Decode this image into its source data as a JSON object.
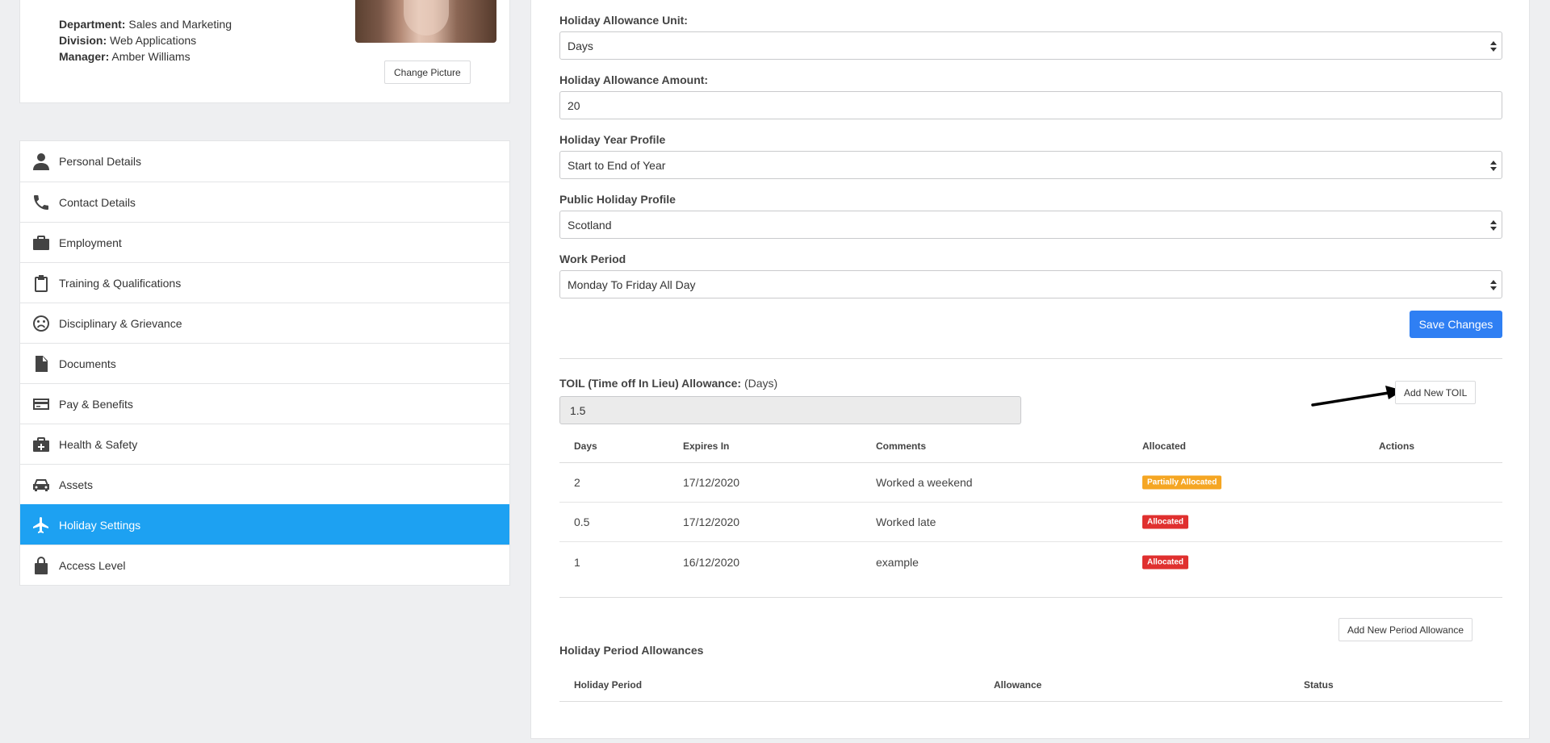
{
  "profile": {
    "department_label": "Department:",
    "department": "Sales and Marketing",
    "division_label": "Division:",
    "division": "Web Applications",
    "manager_label": "Manager:",
    "manager": "Amber Williams",
    "change_picture": "Change Picture"
  },
  "menu": [
    {
      "label": "Personal Details",
      "icon": "person-icon"
    },
    {
      "label": "Contact Details",
      "icon": "phone-icon"
    },
    {
      "label": "Employment",
      "icon": "briefcase-icon"
    },
    {
      "label": "Training & Qualifications",
      "icon": "clipboard-icon"
    },
    {
      "label": "Disciplinary & Grievance",
      "icon": "sad-face-icon"
    },
    {
      "label": "Documents",
      "icon": "document-icon"
    },
    {
      "label": "Pay & Benefits",
      "icon": "credit-card-icon"
    },
    {
      "label": "Health & Safety",
      "icon": "medical-kit-icon"
    },
    {
      "label": "Assets",
      "icon": "car-icon"
    },
    {
      "label": "Holiday Settings",
      "icon": "airplane-icon",
      "active": true
    },
    {
      "label": "Access Level",
      "icon": "lock-icon"
    }
  ],
  "form": {
    "unit_label": "Holiday Allowance Unit:",
    "unit_value": "Days",
    "amount_label": "Holiday Allowance Amount:",
    "amount_value": "20",
    "year_profile_label": "Holiday Year Profile",
    "year_profile_value": "Start to End of Year",
    "public_profile_label": "Public Holiday Profile",
    "public_profile_value": "Scotland",
    "work_period_label": "Work Period",
    "work_period_value": "Monday To Friday All Day",
    "save_label": "Save Changes"
  },
  "toil": {
    "label": "TOIL (Time off In Lieu) Allowance:",
    "unit": "(Days)",
    "value": "1.5",
    "add_button": "Add New TOIL",
    "columns": [
      "Days",
      "Expires In",
      "Comments",
      "Allocated",
      "Actions"
    ],
    "rows": [
      {
        "days": "2",
        "expires": "17/12/2020",
        "comment": "Worked a weekend",
        "allocated": "Partially Allocated",
        "status_color": "#f5a623"
      },
      {
        "days": "0.5",
        "expires": "17/12/2020",
        "comment": "Worked late",
        "allocated": "Allocated",
        "status_color": "#e0302f"
      },
      {
        "days": "1",
        "expires": "16/12/2020",
        "comment": "example",
        "allocated": "Allocated",
        "status_color": "#e0302f"
      }
    ]
  },
  "period": {
    "add_button": "Add New Period Allowance",
    "title": "Holiday Period Allowances",
    "columns": [
      "Holiday Period",
      "Allowance",
      "Status"
    ]
  },
  "colors": {
    "accent": "#1da1f2",
    "primary_button": "#2f7ff3"
  }
}
